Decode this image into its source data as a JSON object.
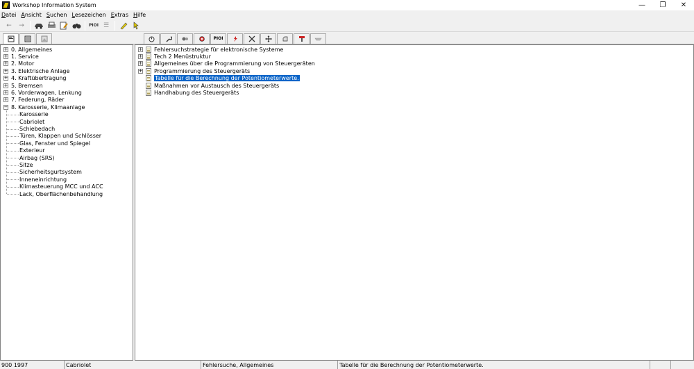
{
  "window": {
    "title": "Workshop Information System"
  },
  "menu": [
    {
      "label": "Datei",
      "ul": "D",
      "rest": "atei"
    },
    {
      "label": "Ansicht",
      "ul": "A",
      "rest": "nsicht"
    },
    {
      "label": "Suchen",
      "ul": "S",
      "rest": "uchen"
    },
    {
      "label": "Lesezeichen",
      "ul": "L",
      "rest": "esezeichen"
    },
    {
      "label": "Extras",
      "ul": "E",
      "rest": "xtras"
    },
    {
      "label": "Hilfe",
      "ul": "H",
      "rest": "ilfe"
    }
  ],
  "toolbar": {
    "pioi_label": "PIOI"
  },
  "left_tree": [
    {
      "label": "0. Allgemeines",
      "expander": "+"
    },
    {
      "label": "1. Service",
      "expander": "+"
    },
    {
      "label": "2. Motor",
      "expander": "+"
    },
    {
      "label": "3. Elektrische Anlage",
      "expander": "+"
    },
    {
      "label": "4. Kraftübertragung",
      "expander": "+"
    },
    {
      "label": "5. Bremsen",
      "expander": "+"
    },
    {
      "label": "6. Vorderwagen, Lenkung",
      "expander": "+"
    },
    {
      "label": "7. Federung, Räder",
      "expander": "+"
    },
    {
      "label": "8. Karosserie, Klimaanlage",
      "expander": "−"
    }
  ],
  "left_children": [
    "Karosserie",
    "Cabriolet",
    "Schiebedach",
    "Türen, Klappen und Schlösser",
    "Glas, Fenster und Spiegel",
    "Exterieur",
    "Airbag (SRS)",
    "Sitze",
    "Sicherheitsgurtsystem",
    "Inneneinrichtung",
    "Klimasteuerung MCC und ACC",
    "Lack, Oberflächenbehandlung"
  ],
  "right_tree": [
    {
      "label": "Fehlersuchstrategie für elektronische Systeme",
      "expander": "+"
    },
    {
      "label": "Tech 2 Menüstruktur",
      "expander": "+"
    },
    {
      "label": "Allgemeines über die Programmierung von Steuergeräten",
      "expander": "+"
    },
    {
      "label": "Programmierung des Steuergeräts",
      "expander": "+"
    },
    {
      "label": "Tabelle für die Berechnung der Potentiometerwerte.",
      "expander": "",
      "selected": true
    },
    {
      "label": "Maßnahmen vor Austausch des Steuergeräts",
      "expander": ""
    },
    {
      "label": "Handhabung des Steuergeräts",
      "expander": ""
    }
  ],
  "status": {
    "model": "900 1997",
    "section": "Cabriolet",
    "category": "Fehlersuche, Allgemeines",
    "document": "Tabelle für die Berechnung der Potentiometerwerte."
  }
}
